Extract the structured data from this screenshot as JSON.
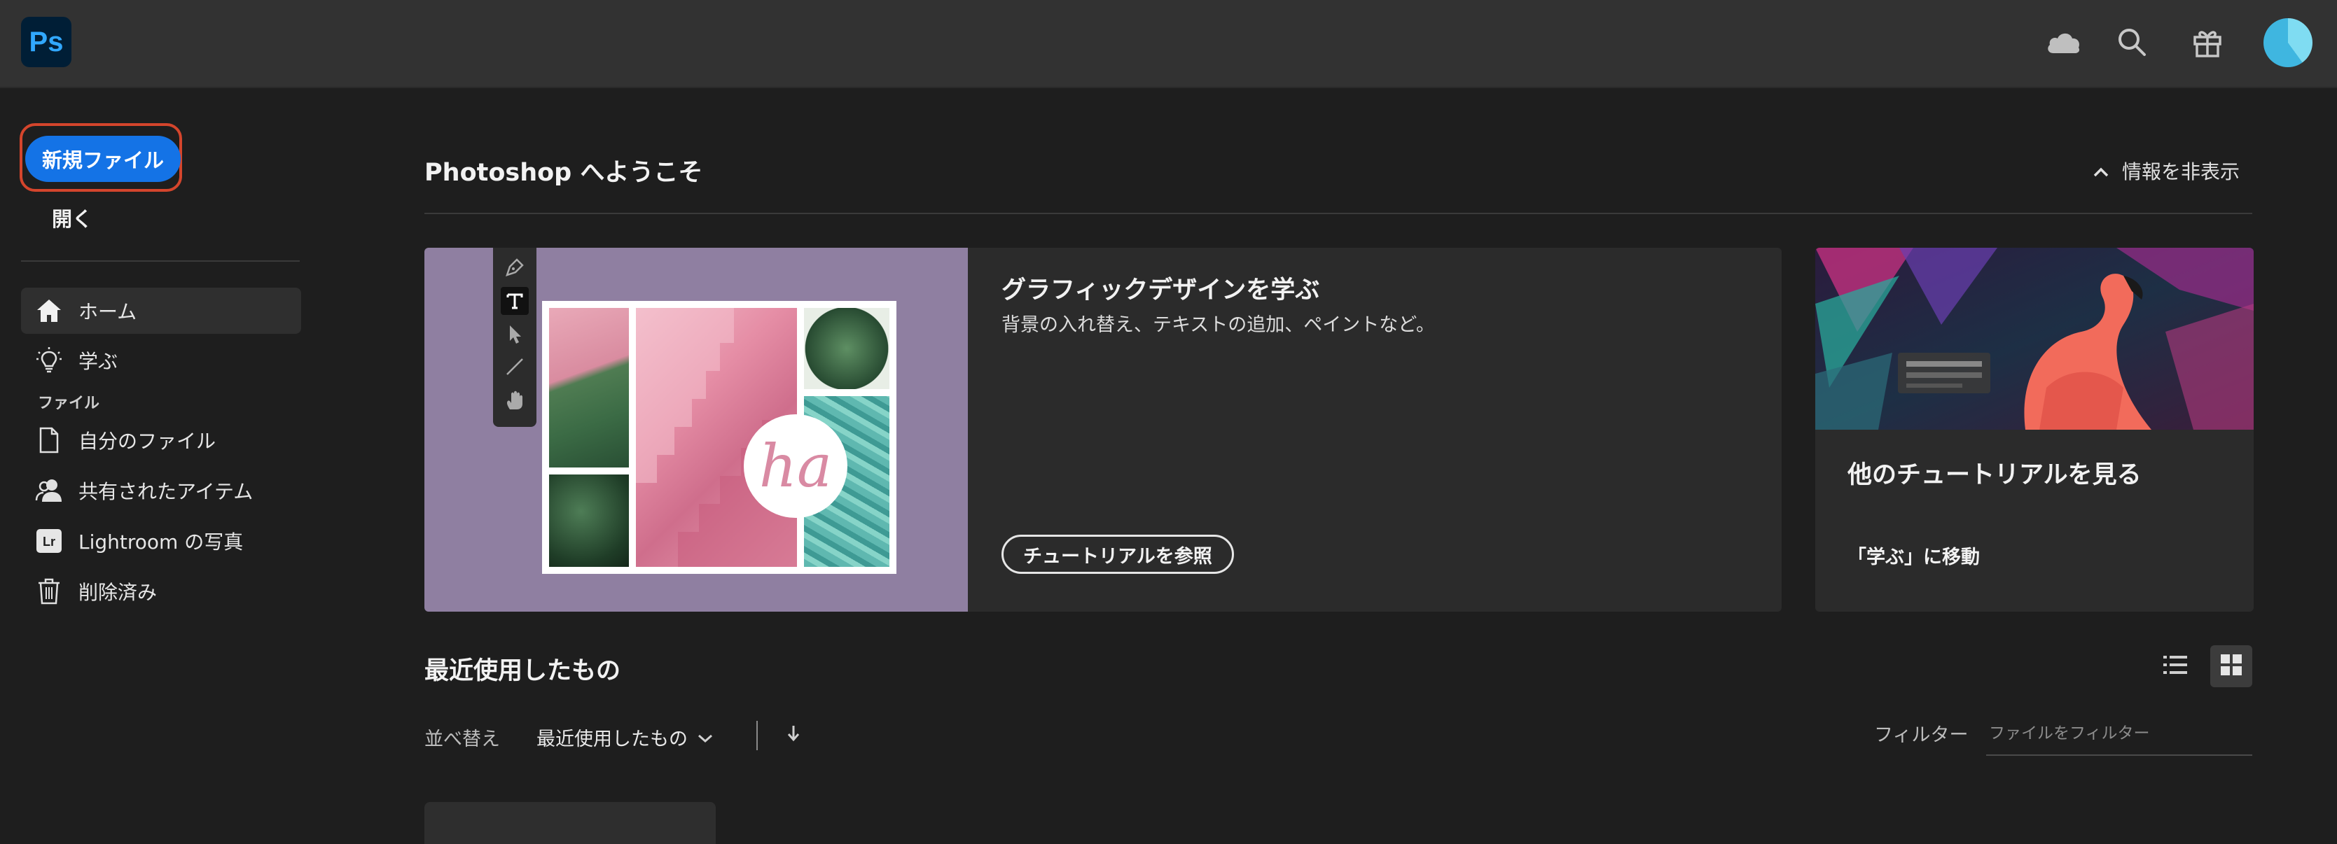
{
  "app": {
    "logo_text": "Ps",
    "accent": "#1473e6"
  },
  "topbar": {
    "icons": [
      "cloud-icon",
      "search-icon",
      "gift-icon",
      "avatar"
    ]
  },
  "sidebar": {
    "new_file_label": "新規ファイル",
    "open_label": "開く",
    "items": [
      {
        "label": "ホーム",
        "icon": "home-icon",
        "active": true
      },
      {
        "label": "学ぶ",
        "icon": "lightbulb-icon",
        "active": false
      }
    ],
    "files_section_label": "ファイル",
    "file_items": [
      {
        "label": "自分のファイル",
        "icon": "document-icon"
      },
      {
        "label": "共有されたアイテム",
        "icon": "shared-users-icon"
      },
      {
        "label": "Lightroom の写真",
        "icon": "lightroom-icon"
      },
      {
        "label": "削除済み",
        "icon": "trash-icon"
      }
    ]
  },
  "welcome": {
    "title": "Photoshop へようこそ",
    "hide_info_label": "情報を非表示"
  },
  "featured": {
    "title": "グラフィックデザインを学ぶ",
    "subtitle": "背景の入れ替え、テキストの追加、ペイントなど。",
    "button_label": "チュートリアルを参照",
    "art_text": "ha"
  },
  "more_tutorials": {
    "title": "他のチュートリアルを見る",
    "link_label": "「学ぶ」に移動"
  },
  "recent": {
    "title": "最近使用したもの",
    "sort_label": "並べ替え",
    "sort_value": "最近使用したもの",
    "filter_label": "フィルター",
    "filter_placeholder": "ファイルをフィルター",
    "view_mode": "grid"
  }
}
